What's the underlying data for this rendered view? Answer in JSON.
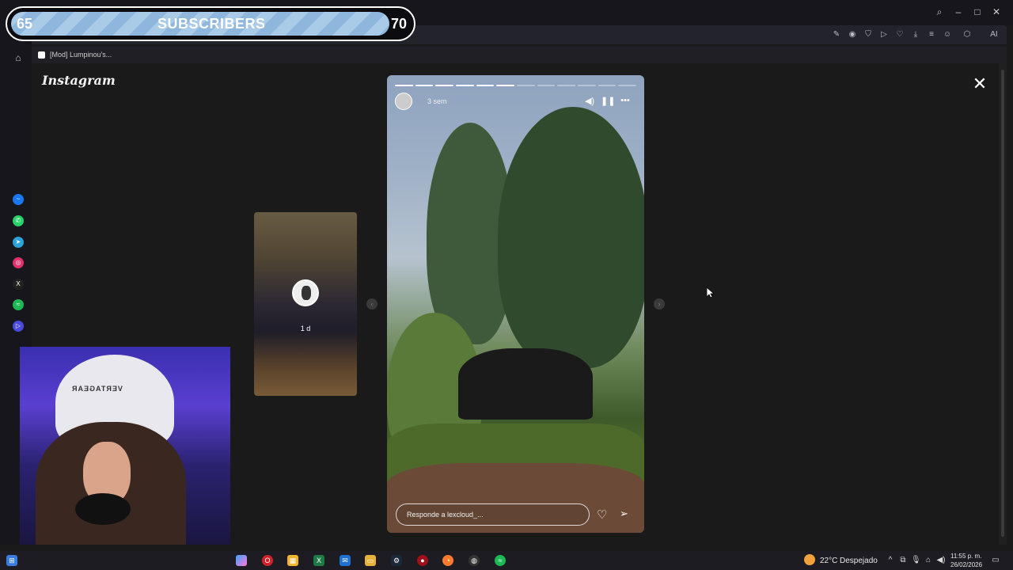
{
  "overlay": {
    "subs_current": "65",
    "subs_label": "SUBSCRIBERS",
    "subs_goal": "70",
    "subs_progress": 0.92
  },
  "browser": {
    "tab_title": "[Mod] Lumpinou's...",
    "toolbar_ai_label": "AI",
    "window_controls": [
      "search-icon",
      "minimize-icon",
      "maximize-icon",
      "close-icon"
    ],
    "toolbar_icons": [
      "edit-icon",
      "camera-icon",
      "shield-icon",
      "play-icon",
      "heart-icon",
      "download-icon",
      "menu-icon",
      "profile-icon",
      "extension-icon"
    ]
  },
  "sidebar": {
    "icons": [
      "home-icon",
      "messenger-icon",
      "whatsapp-icon",
      "telegram-icon",
      "instagram-icon",
      "x-icon",
      "spotify-icon",
      "player-icon"
    ],
    "colors": {
      "messenger": "#1877f2",
      "whatsapp": "#25d366",
      "telegram": "#2aa3dd",
      "instagram": "#e1306c",
      "x": "#222222",
      "spotify": "#1db954",
      "player": "#4a4adf"
    }
  },
  "instagram": {
    "logo": "Instagram",
    "close_symbol": "✕",
    "prev_story_time": "1 d",
    "story_time": "3 sem",
    "story_segments_total": 12,
    "story_segments_done": 6,
    "reply_placeholder": "Responde a lexcloud_..."
  },
  "webcam": {
    "chair_brand": "VERTAGEAR"
  },
  "taskbar": {
    "apps": [
      "windows-start-icon",
      "copilot-icon",
      "opera-icon",
      "store-icon",
      "excel-icon",
      "outlook-icon",
      "files-icon",
      "steam-icon",
      "app-icon",
      "firefox-icon",
      "obs-icon",
      "spotify-icon"
    ],
    "weather_temp": "22°C",
    "weather_desc": "Despejado",
    "time": "11:55 p. m.",
    "date": "26/02/2026"
  }
}
